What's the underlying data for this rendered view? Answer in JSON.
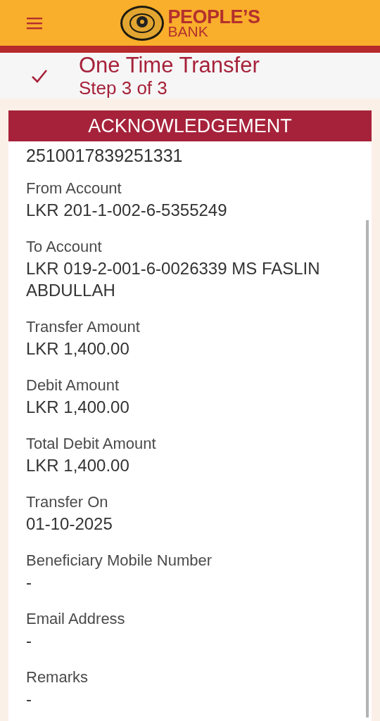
{
  "header": {
    "brand_line_1": "PEOPLE’S",
    "brand_line_2": "BANK"
  },
  "step": {
    "title": "One Time Transfer",
    "subtitle": "Step 3 of 3",
    "done": true
  },
  "card": {
    "title": "ACKNOWLEDGEMENT",
    "reference": "2510017839251331",
    "fields": [
      {
        "label": "From Account",
        "value": "LKR 201-1-002-6-5355249"
      },
      {
        "label": "To Account",
        "value": "LKR 019-2-001-6-0026339 MS FASLIN ABDULLAH"
      },
      {
        "label": "Transfer Amount",
        "value": "LKR 1,400.00"
      },
      {
        "label": "Debit Amount",
        "value": "LKR 1,400.00"
      },
      {
        "label": "Total Debit Amount",
        "value": "LKR 1,400.00"
      },
      {
        "label": "Transfer On",
        "value": "01-10-2025"
      },
      {
        "label": "Beneficiary Mobile Number",
        "value": "-"
      },
      {
        "label": "Email Address",
        "value": "-"
      },
      {
        "label": "Remarks",
        "value": "-"
      }
    ]
  }
}
